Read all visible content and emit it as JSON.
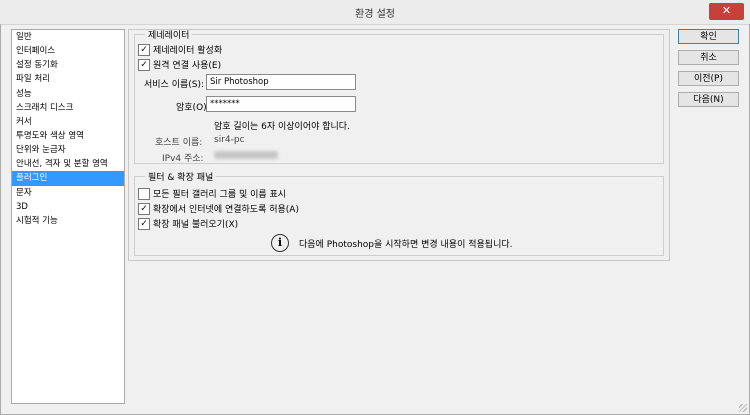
{
  "window": {
    "title": "환경 설정",
    "close_glyph": "✕"
  },
  "categories": [
    {
      "label": "일반"
    },
    {
      "label": "인터페이스"
    },
    {
      "label": "설정 동기화"
    },
    {
      "label": "파일 처리"
    },
    {
      "label": "성능"
    },
    {
      "label": "스크래치 디스크"
    },
    {
      "label": "커서"
    },
    {
      "label": "투명도와 색상 영역"
    },
    {
      "label": "단위와 눈금자"
    },
    {
      "label": "안내선, 격자 및 분할 영역"
    },
    {
      "label": "플러그인",
      "selected": true
    },
    {
      "label": "문자"
    },
    {
      "label": "3D"
    },
    {
      "label": "시험적 기능"
    }
  ],
  "generator": {
    "legend": "제네레이터",
    "enable": {
      "label": "제네레이터 활성화",
      "checked": true
    },
    "remote": {
      "label": "원격 연결 사용(E)",
      "checked": true
    },
    "service_name": {
      "label": "서비스 이름(S):",
      "value": "Sir Photoshop"
    },
    "password": {
      "label": "암호(O):",
      "value": "*******"
    },
    "password_hint": "암호 길이는 6자 이상이어야 합니다.",
    "host": {
      "label": "호스트 이름:",
      "value": "sir4-pc"
    },
    "ipv4": {
      "label": "IPv4 주소:"
    }
  },
  "filters": {
    "legend": "필터 & 확장 패널",
    "show_all": {
      "label": "모든 필터 갤러리 그룹 및 이름 표시",
      "checked": false
    },
    "allow_internet": {
      "label": "확장에서 인터넷에 연결하도록 허용(A)",
      "checked": true
    },
    "load_panels": {
      "label": "확장 패널 불러오기(X)",
      "checked": true
    },
    "info_glyph": "i",
    "restart_note": "다음에 Photoshop을 시작하면 변경 내용이 적용됩니다."
  },
  "buttons": {
    "ok": "확인",
    "cancel": "취소",
    "prev": "이전(P)",
    "next": "다음(N)"
  },
  "checkmark": "✓"
}
